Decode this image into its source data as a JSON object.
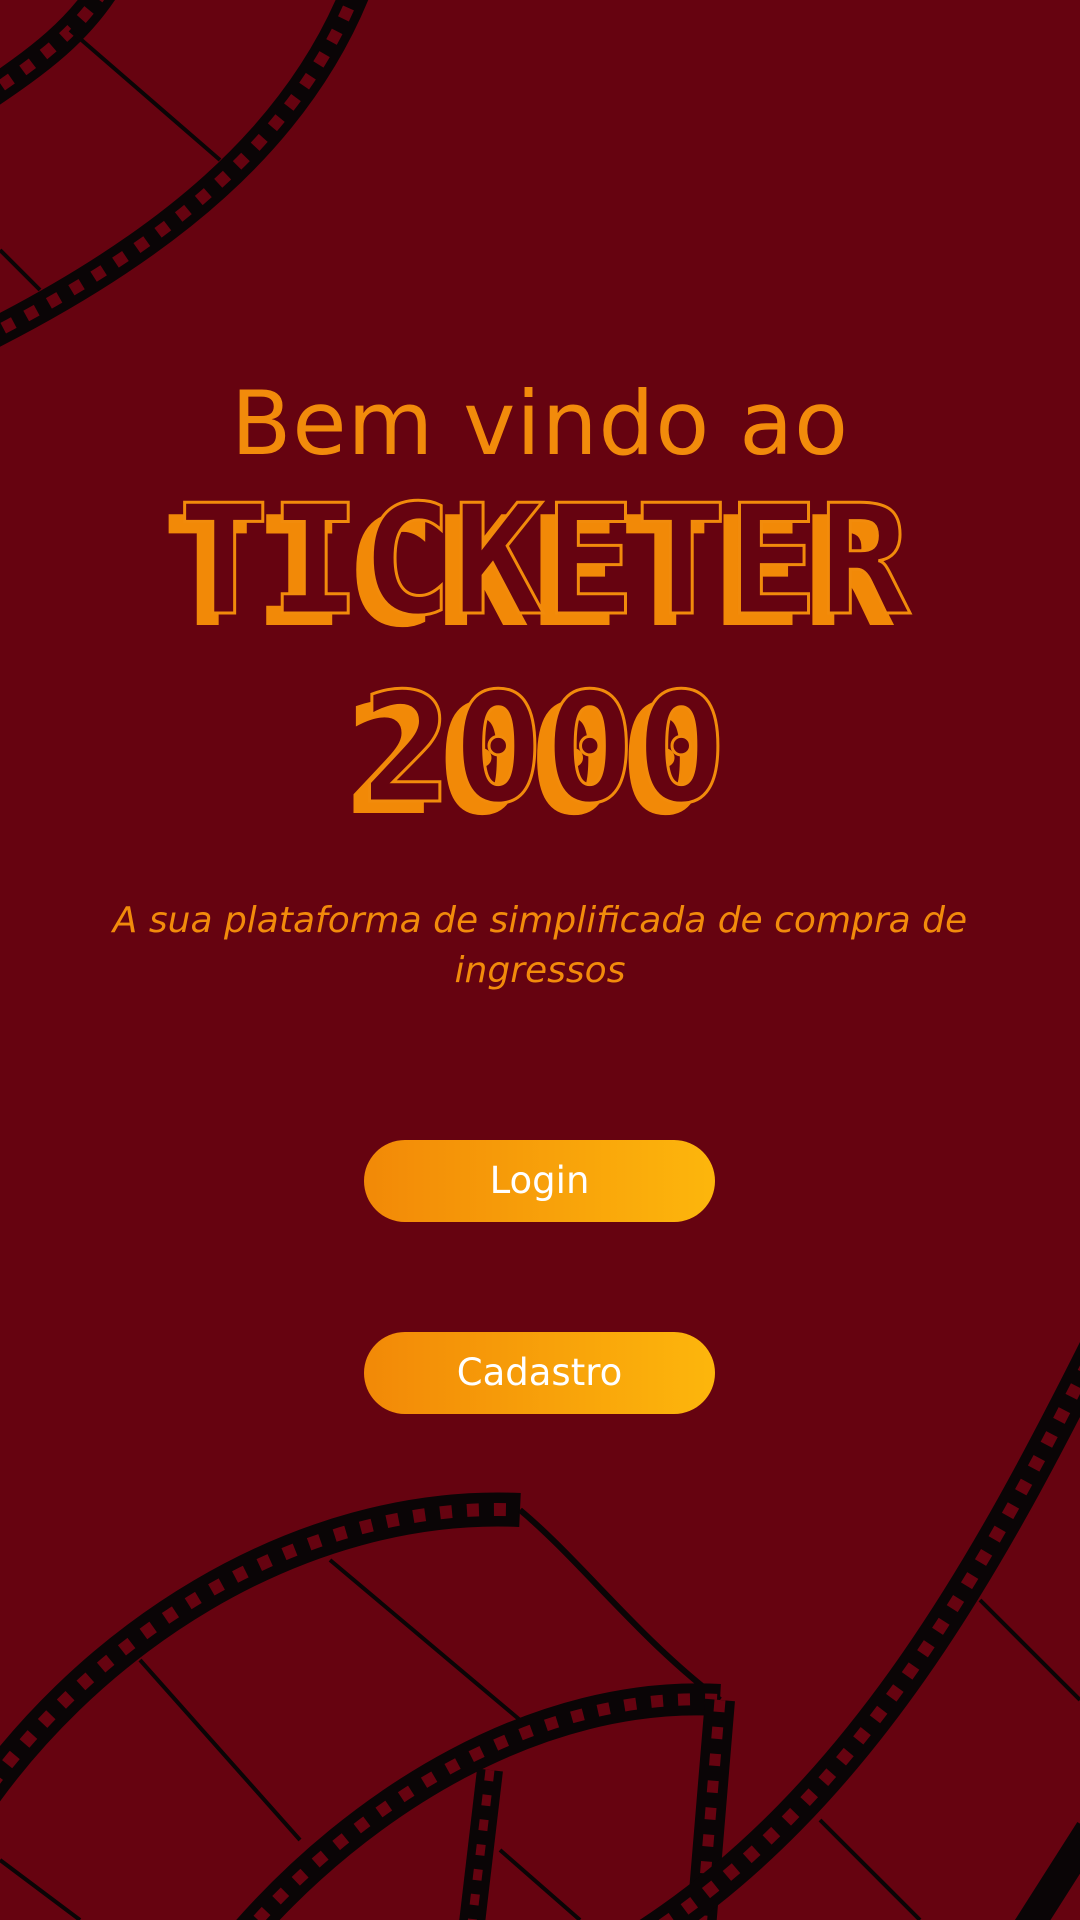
{
  "welcome": {
    "title": "Bem vindo ao"
  },
  "logo": {
    "line1": "TICKETER",
    "line2": "2000"
  },
  "tagline": "A sua plataforma de simplificada de compra de ingressos",
  "actions": {
    "login_label": "Login",
    "signup_label": "Cadastro"
  },
  "colors": {
    "background": "#660310",
    "accent": "#f28b0b",
    "button_gradient_start": "#f28907",
    "button_gradient_end": "#fdb60c",
    "film": "#0a0506"
  },
  "decorations": [
    "film-strip-top-left",
    "film-strip-bottom-left",
    "film-strip-bottom-middle",
    "film-strip-bottom-right"
  ]
}
